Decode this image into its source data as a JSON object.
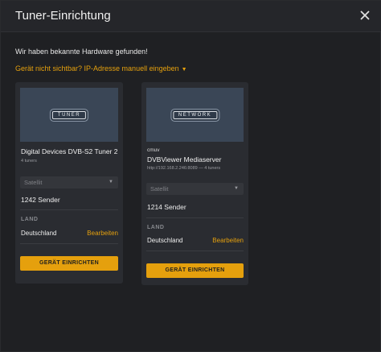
{
  "dialog": {
    "title": "Tuner-Einrichtung",
    "found_text": "Wir haben bekannte Hardware gefunden!",
    "manual_link": "Gerät nicht sichtbar? IP-Adresse manuell eingeben",
    "manual_caret": "▼"
  },
  "colors": {
    "accent": "#e5a00d",
    "background": "#1f2023",
    "card": "#2a2c31"
  },
  "cards": [
    {
      "badge": "TUNER",
      "name": "Digital Devices DVB-S2 Tuner 2",
      "sub": "4 tuners",
      "select_value": "Satellit",
      "count": "1242 Sender",
      "land_label": "LAND",
      "country": "Deutschland",
      "edit_label": "Bearbeiten",
      "button": "GERÄT EINRICHTEN"
    },
    {
      "badge": "NETWORK",
      "vendor": "cmuv",
      "name": "DVBViewer Mediaserver",
      "sub": "http://192.168.2.246:8089 — 4 tuners",
      "select_value": "Satellit",
      "count": "1214 Sender",
      "land_label": "LAND",
      "country": "Deutschland",
      "edit_label": "Bearbeiten",
      "button": "GERÄT EINRICHTEN"
    }
  ]
}
